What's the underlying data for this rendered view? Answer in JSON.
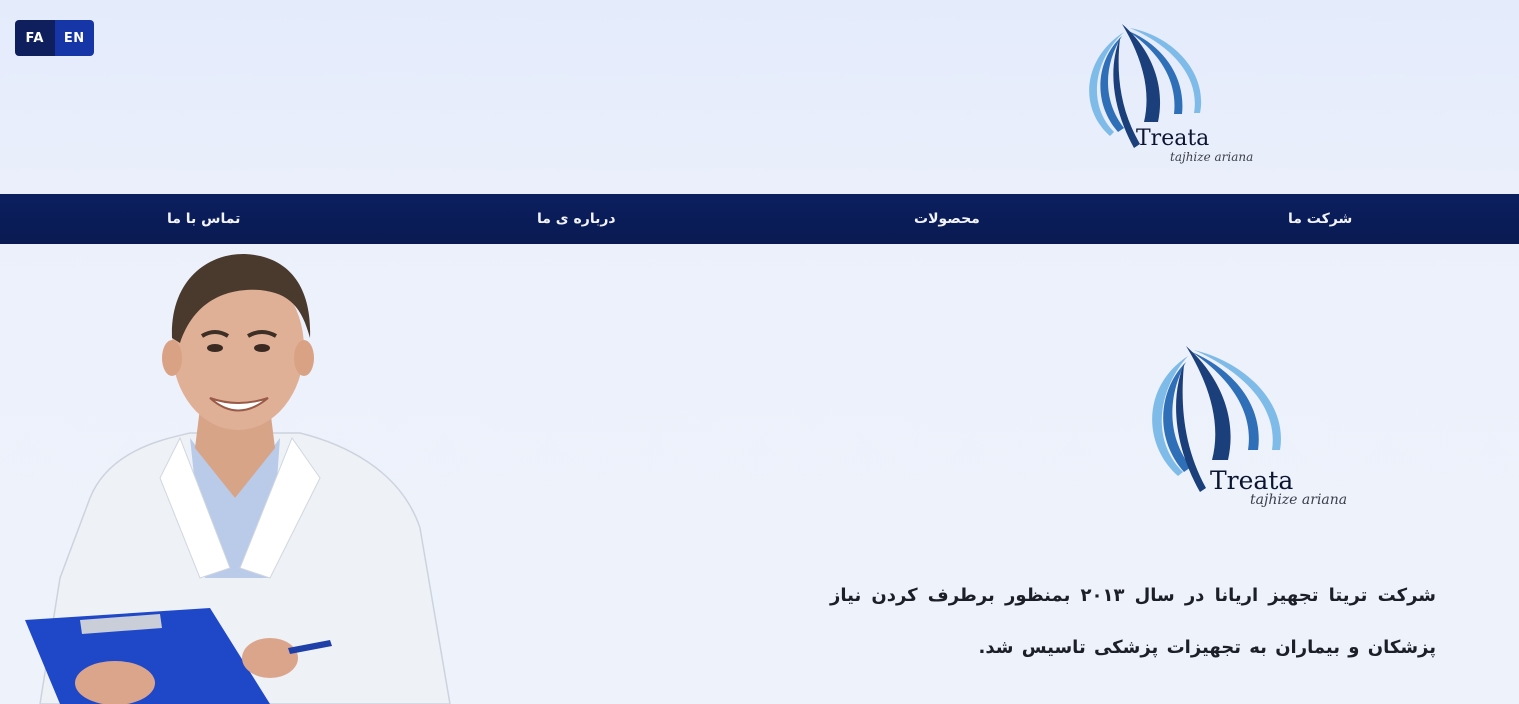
{
  "language_switch": {
    "fa_label": "FA",
    "en_label": "EN"
  },
  "brand": {
    "name": "Treata",
    "tagline": "tajhize ariana"
  },
  "nav": {
    "items": [
      {
        "label": "شرکت ما"
      },
      {
        "label": "محصولات"
      },
      {
        "label": "درباره ی ما"
      },
      {
        "label": "تماس با ما"
      }
    ]
  },
  "hero": {
    "description": "شرکت تریتا تجهیز اریانا در سال ۲۰۱۳ بمنظور برطرف کردن نیاز پزشکان و بیماران به تجهیزات پزشکی تاسیس شد."
  },
  "colors": {
    "nav_background": "#0a1a52",
    "lang_fa_background": "#0f1f5e",
    "lang_en_background": "#1636a8",
    "page_background": "#e9eefb",
    "logo_dark_blue": "#1b3f7a",
    "logo_light_blue": "#6aaee0"
  },
  "icons": {
    "logo": "treata-sail-logo"
  }
}
